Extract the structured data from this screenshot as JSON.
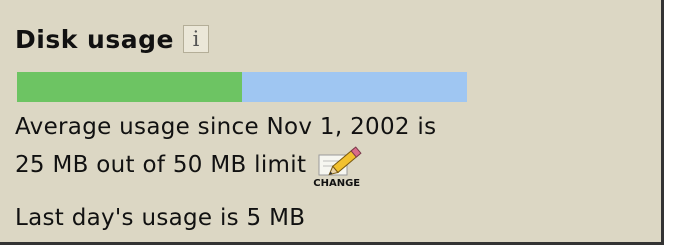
{
  "panel": {
    "title": "Disk usage",
    "info_icon": "info-icon",
    "info_glyph": "i",
    "usage_fraction": 0.5,
    "colors": {
      "background": "#dcd7c4",
      "used": "#6dc463",
      "remaining": "#9fc6f2"
    },
    "average_line": "Average usage since Nov 1, 2002 is",
    "limit_line": "25 MB out of 50 MB limit",
    "change_icon": "pencil-edit-icon",
    "change_label": "CHANGE",
    "last_day_line": "Last day's usage is 5 MB"
  }
}
